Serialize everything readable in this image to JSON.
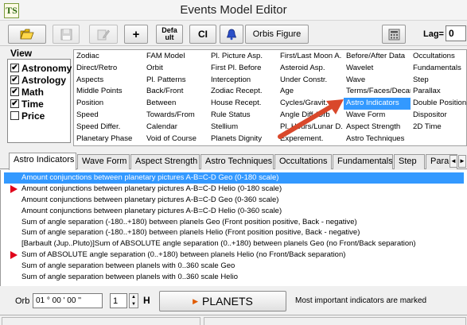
{
  "window": {
    "title": "Events Model Editor",
    "logo_text": "TS"
  },
  "toolbar": {
    "open_icon": "folder-open-icon",
    "save_icon": "floppy-save-icon",
    "edit_icon": "edit-icon",
    "add_label": "+",
    "default_line1": "Defa",
    "default_line2": "ult",
    "ci_label": "CI",
    "bell_icon": "bell-icon",
    "orbis_label": "Orbis Figure",
    "calc_icon": "calculator-icon",
    "lag_label": "Lag=",
    "lag_value": "0"
  },
  "view": {
    "title": "View",
    "items": [
      {
        "label": "Astronomy",
        "checked": true
      },
      {
        "label": "Astrology",
        "checked": true
      },
      {
        "label": "Math",
        "checked": true
      },
      {
        "label": "Time",
        "checked": true
      },
      {
        "label": "Price",
        "checked": false
      }
    ]
  },
  "indicators": {
    "columns": [
      {
        "items": [
          "Zodiac",
          "Direct/Retro",
          "Aspects",
          "Middle Points",
          "Position",
          "Speed",
          "Speed Differ.",
          "Planetary Phase"
        ]
      },
      {
        "items": [
          "FAM Model",
          "Orbit",
          "Pl. Patterns",
          "Back/Front",
          "Between",
          "Towards/From",
          "Calendar",
          "Void of Course"
        ]
      },
      {
        "items": [
          "Pl. Picture Asp.",
          "First Pl. Before",
          "Interception",
          "Zodiac Recept.",
          "House Recept.",
          "Rule Status",
          "Stellium",
          "Planets Dignity"
        ]
      },
      {
        "items": [
          "First/Last Moon A.",
          "Asteroid Asp.",
          "Under Constr.",
          "Age",
          "Cycles/Gravit.",
          "Angle Diff./Orb",
          "Pl. Hours/Lunar D.",
          "Experement."
        ]
      },
      {
        "items": [
          "Before/After Data",
          "Wavelet",
          "Wave",
          "Terms/Faces/Decan",
          "Astro Indicators",
          "Wave Form",
          "Aspect Strength",
          "Astro Techniques"
        ]
      },
      {
        "items": [
          "Occultations",
          "Fundamentals",
          "Step",
          "Parallax",
          "Double Position",
          "Dispositor",
          "2D Time"
        ]
      }
    ],
    "selected": "Astro Indicators"
  },
  "tabs": {
    "items": [
      "Astro Indicators",
      "Wave Form",
      "Aspect Strength",
      "Astro Techniques",
      "Occultations",
      "Fundamentals",
      "Step",
      "Parallax"
    ],
    "active": "Astro Indicators",
    "scroll_left": "◄",
    "scroll_right": "►"
  },
  "list": {
    "items": [
      {
        "text": "Amount conjunctions between planetary pictures A-B=C-D Geo (0-180 scale)",
        "marked": false,
        "selected": true
      },
      {
        "text": "Amount conjunctions between planetary pictures A-B=C-D Helio (0-180 scale)",
        "marked": true,
        "selected": false
      },
      {
        "text": "Amount conjunctions between planetary pictures A-B=C-D Geo (0-360 scale)",
        "marked": false,
        "selected": false
      },
      {
        "text": "Amount conjunctions between planetary pictures A-B=C-D Helio (0-360 scale)",
        "marked": false,
        "selected": false
      },
      {
        "text": "Sum of angle separation (-180..+180) between planels Geo (Front position positive, Back - negative)",
        "marked": false,
        "selected": false
      },
      {
        "text": "Sum of angle separation (-180..+180) between planels Helio (Front position positive, Back - negative)",
        "marked": false,
        "selected": false
      },
      {
        "text": "[Barbault (Jup..Pluto)]Sum of ABSOLUTE angle separation (0..+180) between planels Geo (no Front/Back separation)",
        "marked": false,
        "selected": false
      },
      {
        "text": "Sum of ABSOLUTE angle separation (0..+180) between planels Helio (no Front/Back separation)",
        "marked": true,
        "selected": false
      },
      {
        "text": "Sum of angle separation between planels with 0..360 scale Geo",
        "marked": false,
        "selected": false
      },
      {
        "text": "Sum of angle separation between planels with 0..360 scale Helio",
        "marked": false,
        "selected": false
      }
    ]
  },
  "bottom": {
    "orb_label": "Orb",
    "orb_value": "01 ° 00 ' 00 ''",
    "harmonic_value": "1",
    "spin_up": "▲",
    "spin_down": "▼",
    "h_label": "H",
    "planets_icon": "play-icon",
    "planets_label": "PLANETS",
    "note": "Most important indicators are marked"
  },
  "colors": {
    "selection": "#3399ff",
    "marker": "#e0001a",
    "arrow": "#d9482b"
  }
}
